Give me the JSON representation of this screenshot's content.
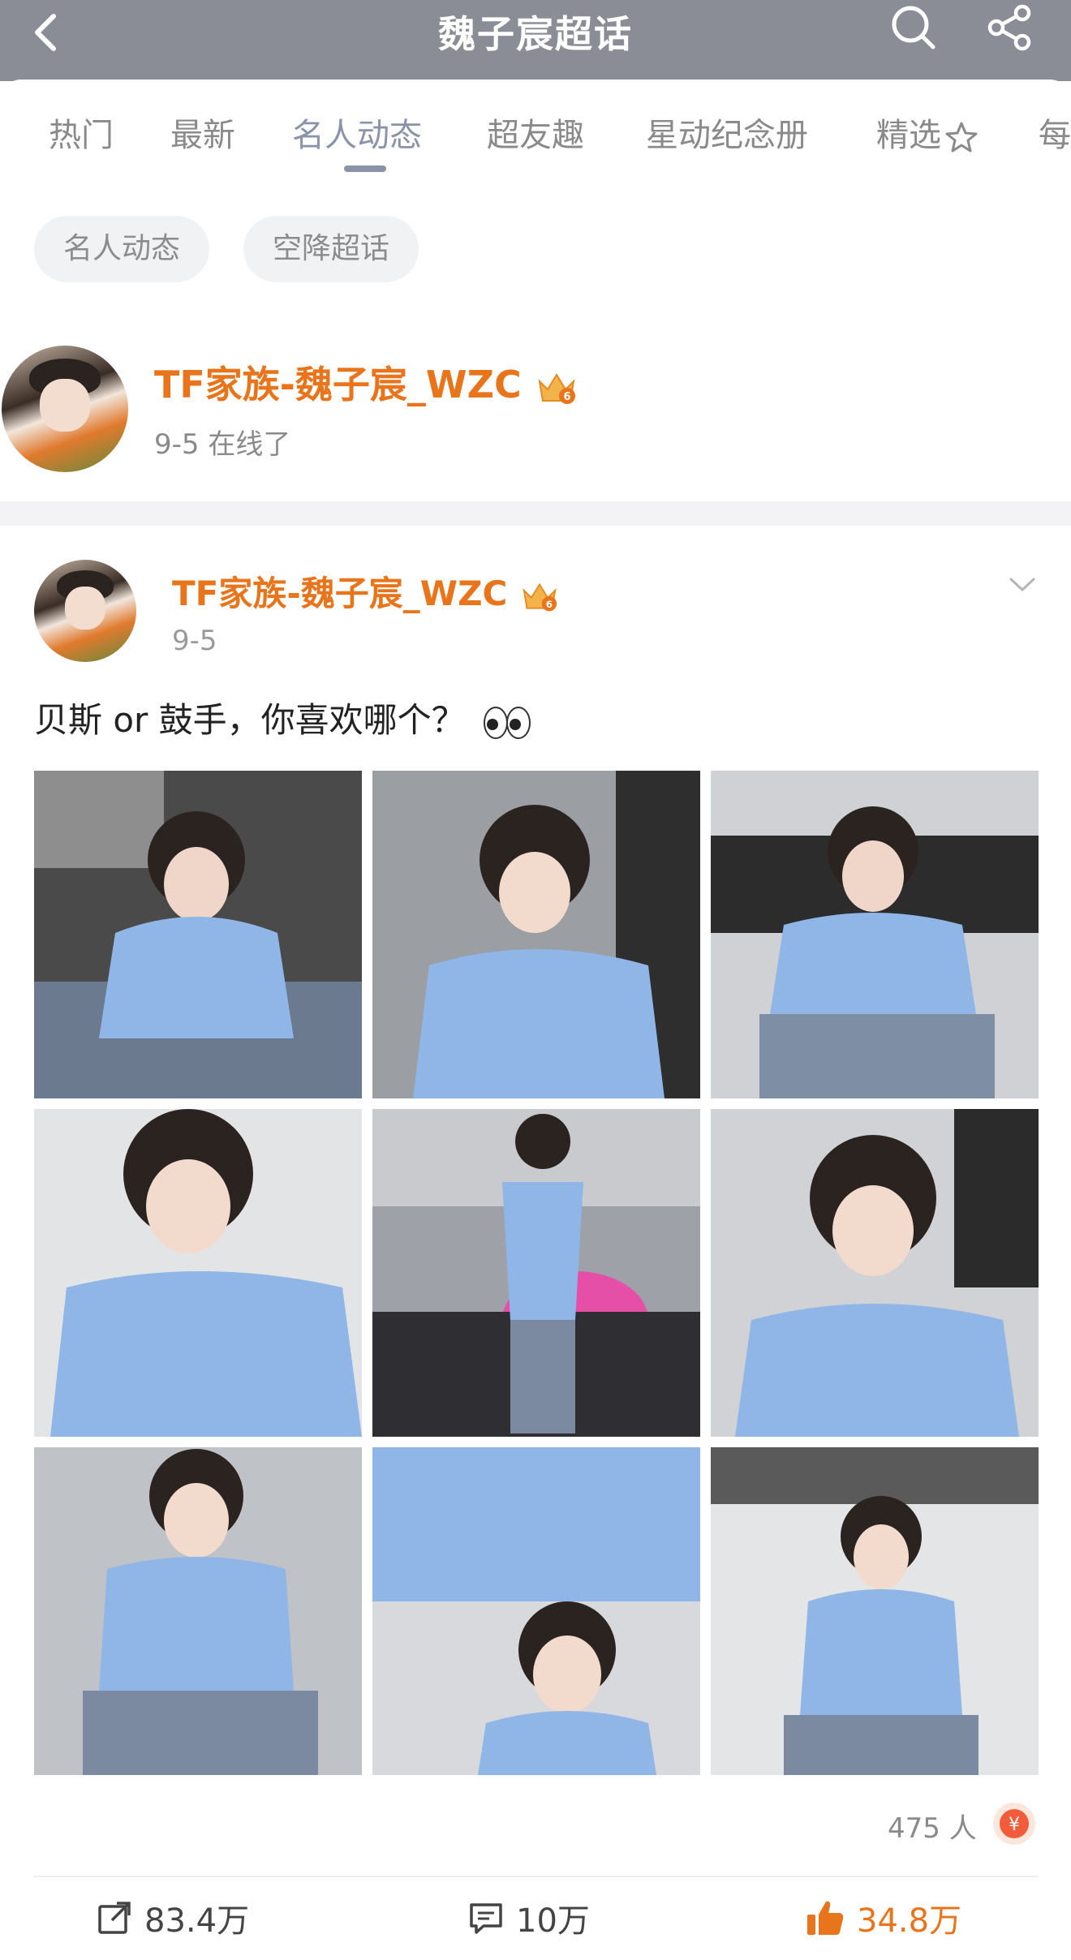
{
  "header": {
    "title": "魏子宸超话"
  },
  "tabs": [
    {
      "label": "热门"
    },
    {
      "label": "最新"
    },
    {
      "label": "名人动态"
    },
    {
      "label": "超友趣"
    },
    {
      "label": "星动纪念册"
    },
    {
      "label": "精选"
    },
    {
      "label": "每"
    }
  ],
  "active_tab": "名人动态",
  "chips": [
    {
      "label": "名人动态"
    },
    {
      "label": "空降超话"
    }
  ],
  "celebrity": {
    "name": "TF家族-魏子宸_WZC",
    "status": "9-5 在线了"
  },
  "post": {
    "author": "TF家族-魏子宸_WZC",
    "date": "9-5",
    "text": "贝斯 or 鼓手，你喜欢哪个？",
    "photo_count": 9,
    "supporters": "475 人",
    "reposts": "83.4万",
    "comments": "10万",
    "likes": "34.8万"
  },
  "colors": {
    "header_bg": "#8a8d96",
    "accent_orange": "#e8741c",
    "active_tab": "#8b93a8",
    "chip_bg": "#f1f2f4"
  },
  "icons": {
    "back": "chevron-left-icon",
    "search": "search-icon",
    "share": "share-icon",
    "crown": "crown-icon",
    "more": "chevron-down-icon",
    "repost": "repost-icon",
    "comment": "comment-icon",
    "like": "like-icon",
    "supporter": "red-envelope-icon"
  }
}
